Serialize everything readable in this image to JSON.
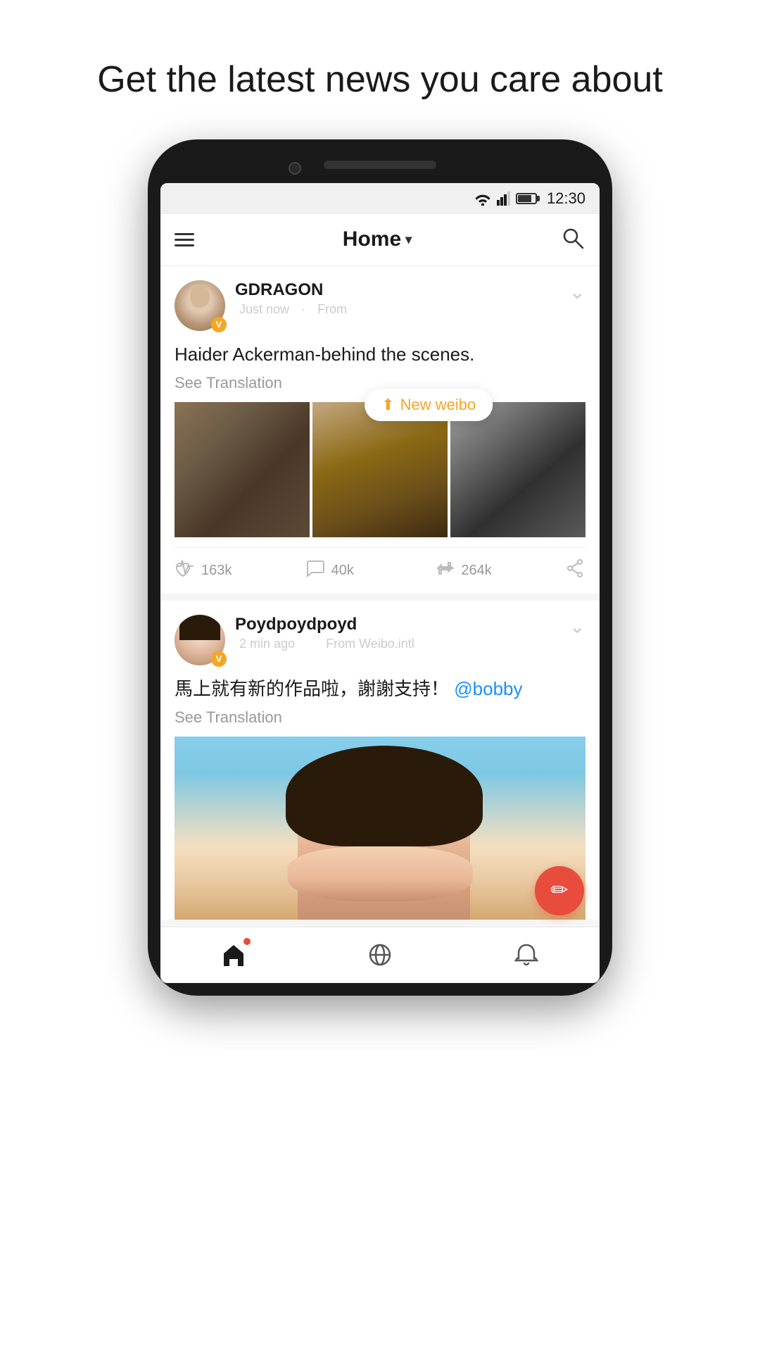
{
  "headline": "Get the latest news you care about",
  "statusBar": {
    "time": "12:30"
  },
  "appBar": {
    "title": "Home",
    "menuLabel": "Menu",
    "searchLabel": "Search"
  },
  "newWeibo": {
    "label": "New weibo"
  },
  "posts": [
    {
      "id": "post1",
      "username": "GDRAGON",
      "timeAgo": "Just now",
      "source": "From",
      "content": "Haider Ackerman-behind the scenes.",
      "seeTranslation": "See Translation",
      "likes": "163k",
      "comments": "40k",
      "reposts": "264k",
      "verified": "V"
    },
    {
      "id": "post2",
      "username": "Poydpoydpoyd",
      "timeAgo": "2 min ago",
      "source": "From Weibo.intl",
      "content": "馬上就有新的作品啦，謝謝支持！",
      "mention": "@bobby",
      "seeTranslation": "See Translation",
      "verified": "V"
    }
  ],
  "bottomNav": {
    "home": "Home",
    "explore": "Explore",
    "notifications": "Notifications"
  },
  "fab": {
    "label": "Compose"
  }
}
